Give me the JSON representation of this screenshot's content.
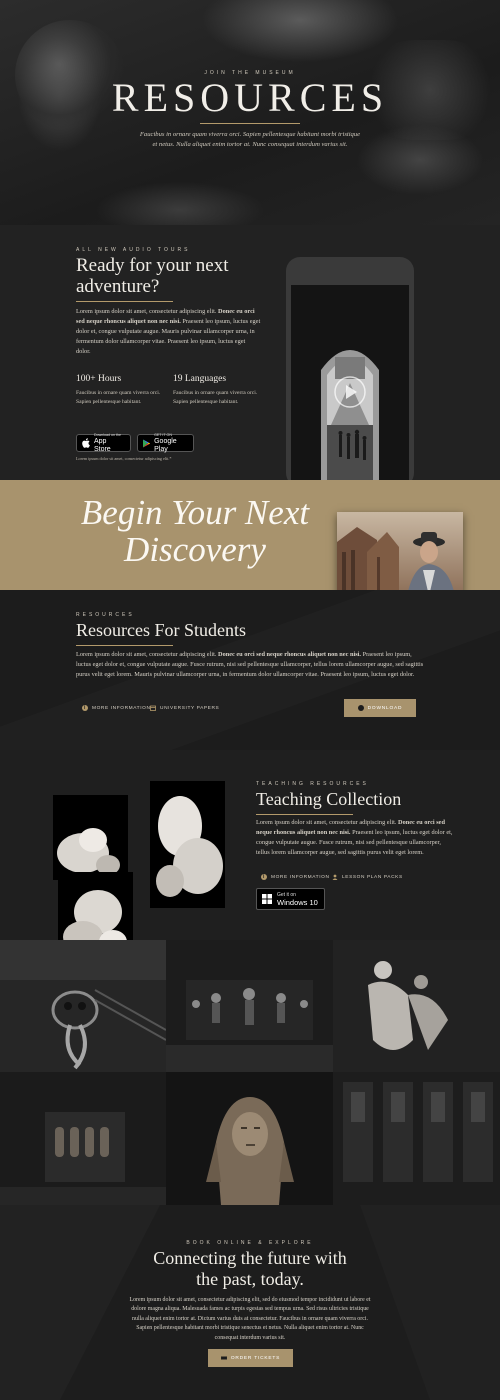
{
  "hero": {
    "kicker": "JOIN THE MUSEUM",
    "title": "RESOURCES",
    "subtitle_line1": "Faucibus in ornare quam viverra orci. Sapien pellentesque habitant morbi tristique",
    "subtitle_line2": "et netus. Nulla aliquet enim tortor at. Nunc consequat interdum varius sit."
  },
  "tours": {
    "kicker": "ALL NEW AUDIO TOURS",
    "title_line1": "Ready for your next",
    "title_line2": "adventure?",
    "para_a": "Lorem ipsum dolor sit amet, consectetur adipiscing elit.",
    "para_bold": "Donec eu orci sed neque rhoncus aliquet non nec nisi.",
    "para_b": "Praesent leo ipsum, luctus eget dolor et, congue vulputate augue. Mauris pulvinar ullamcorper urna, in fermentum dolor ullamcorper vitae. Praesent leo ipsum, luctus eget dolor.",
    "stat1_title": "100+ Hours",
    "stat1_text": "Faucibus in ornare quam viverra orci. Sapien pellentesque habitant.",
    "stat2_title": "19 Languages",
    "stat2_text": "Faucibus in ornare quam viverra orci. Sapien pellentesque habitant.",
    "appstore_small": "Download on the",
    "appstore_big": "App Store",
    "googleplay_small": "GET IT ON",
    "googleplay_big": "Google Play",
    "footnote": "Lorem ipsum dolor sit amet, consectetur adipiscing elit.*"
  },
  "band": {
    "line1": "Begin Your Next",
    "line2": "Discovery"
  },
  "students": {
    "kicker": "RESOURCES",
    "title": "Resources For Students",
    "para_a": "Lorem ipsum dolor sit amet, consectetur adipiscing elit.",
    "para_bold": "Donec eu orci sed neque rhoncus aliquet non nec nisi.",
    "para_b": "Praesent leo ipsum, luctus eget dolor et, congue vulputate augue. Fusce rutrum, nisi sed pellentesque ullamcorper, tellus lorem ullamcorper augue, sed sagittis purus velit eget lorem. Mauris pulvinar ullamcorper urna, in fermentum dolor ullamcorper vitae. Praesent leo ipsum, luctus eget dolor.",
    "link1": "MORE INFORMATION",
    "link2": "UNIVERSITY PAPERS",
    "download": "DOWNLOAD"
  },
  "teaching": {
    "kicker": "TEACHING RESOURCES",
    "title": "Teaching Collection",
    "para_a": "Lorem ipsum dolor sit amet, consectetur adipiscing elit.",
    "para_bold": "Donec eu orci sed neque rhoncus aliquet non nec nisi.",
    "para_b": "Praesent leo ipsum, luctus eget dolor et, congue vulputate augue. Fusce rutrum, nisi sed pellentesque ullamcorper, tellus lorem ullamcorper augue, sed sagittis purus velit eget lorem.",
    "link1": "MORE INFORMATION",
    "link2": "LESSON PLAN PACKS",
    "win_small": "Get it on",
    "win_big": "Windows 10"
  },
  "cta": {
    "kicker": "BOOK ONLINE & EXPLORE",
    "title_line1": "Connecting the future with",
    "title_line2": "the past, today.",
    "para": "Lorem ipsum dolor sit amet, consectetur adipiscing elit, sed do eiusmod tempor incididunt ut labore et dolore magna aliqua. Malesuada fames ac turpis egestas sed tempus urna. Sed risus ultricies tristique nulla aliquet enim tortor at. Dictum varius duis at consectetur. Faucibus in ornare quam viverra orci. Sapien pellentesque habitant morbi tristique senectus et netus. Nulla aliquet enim tortor at. Nunc consequat interdum varius sit.",
    "button": "ORDER TICKETS"
  },
  "colors": {
    "accent_gold": "#b39a6b",
    "band_gold": "#a8936d",
    "background_dark": "#1b1b1b"
  }
}
